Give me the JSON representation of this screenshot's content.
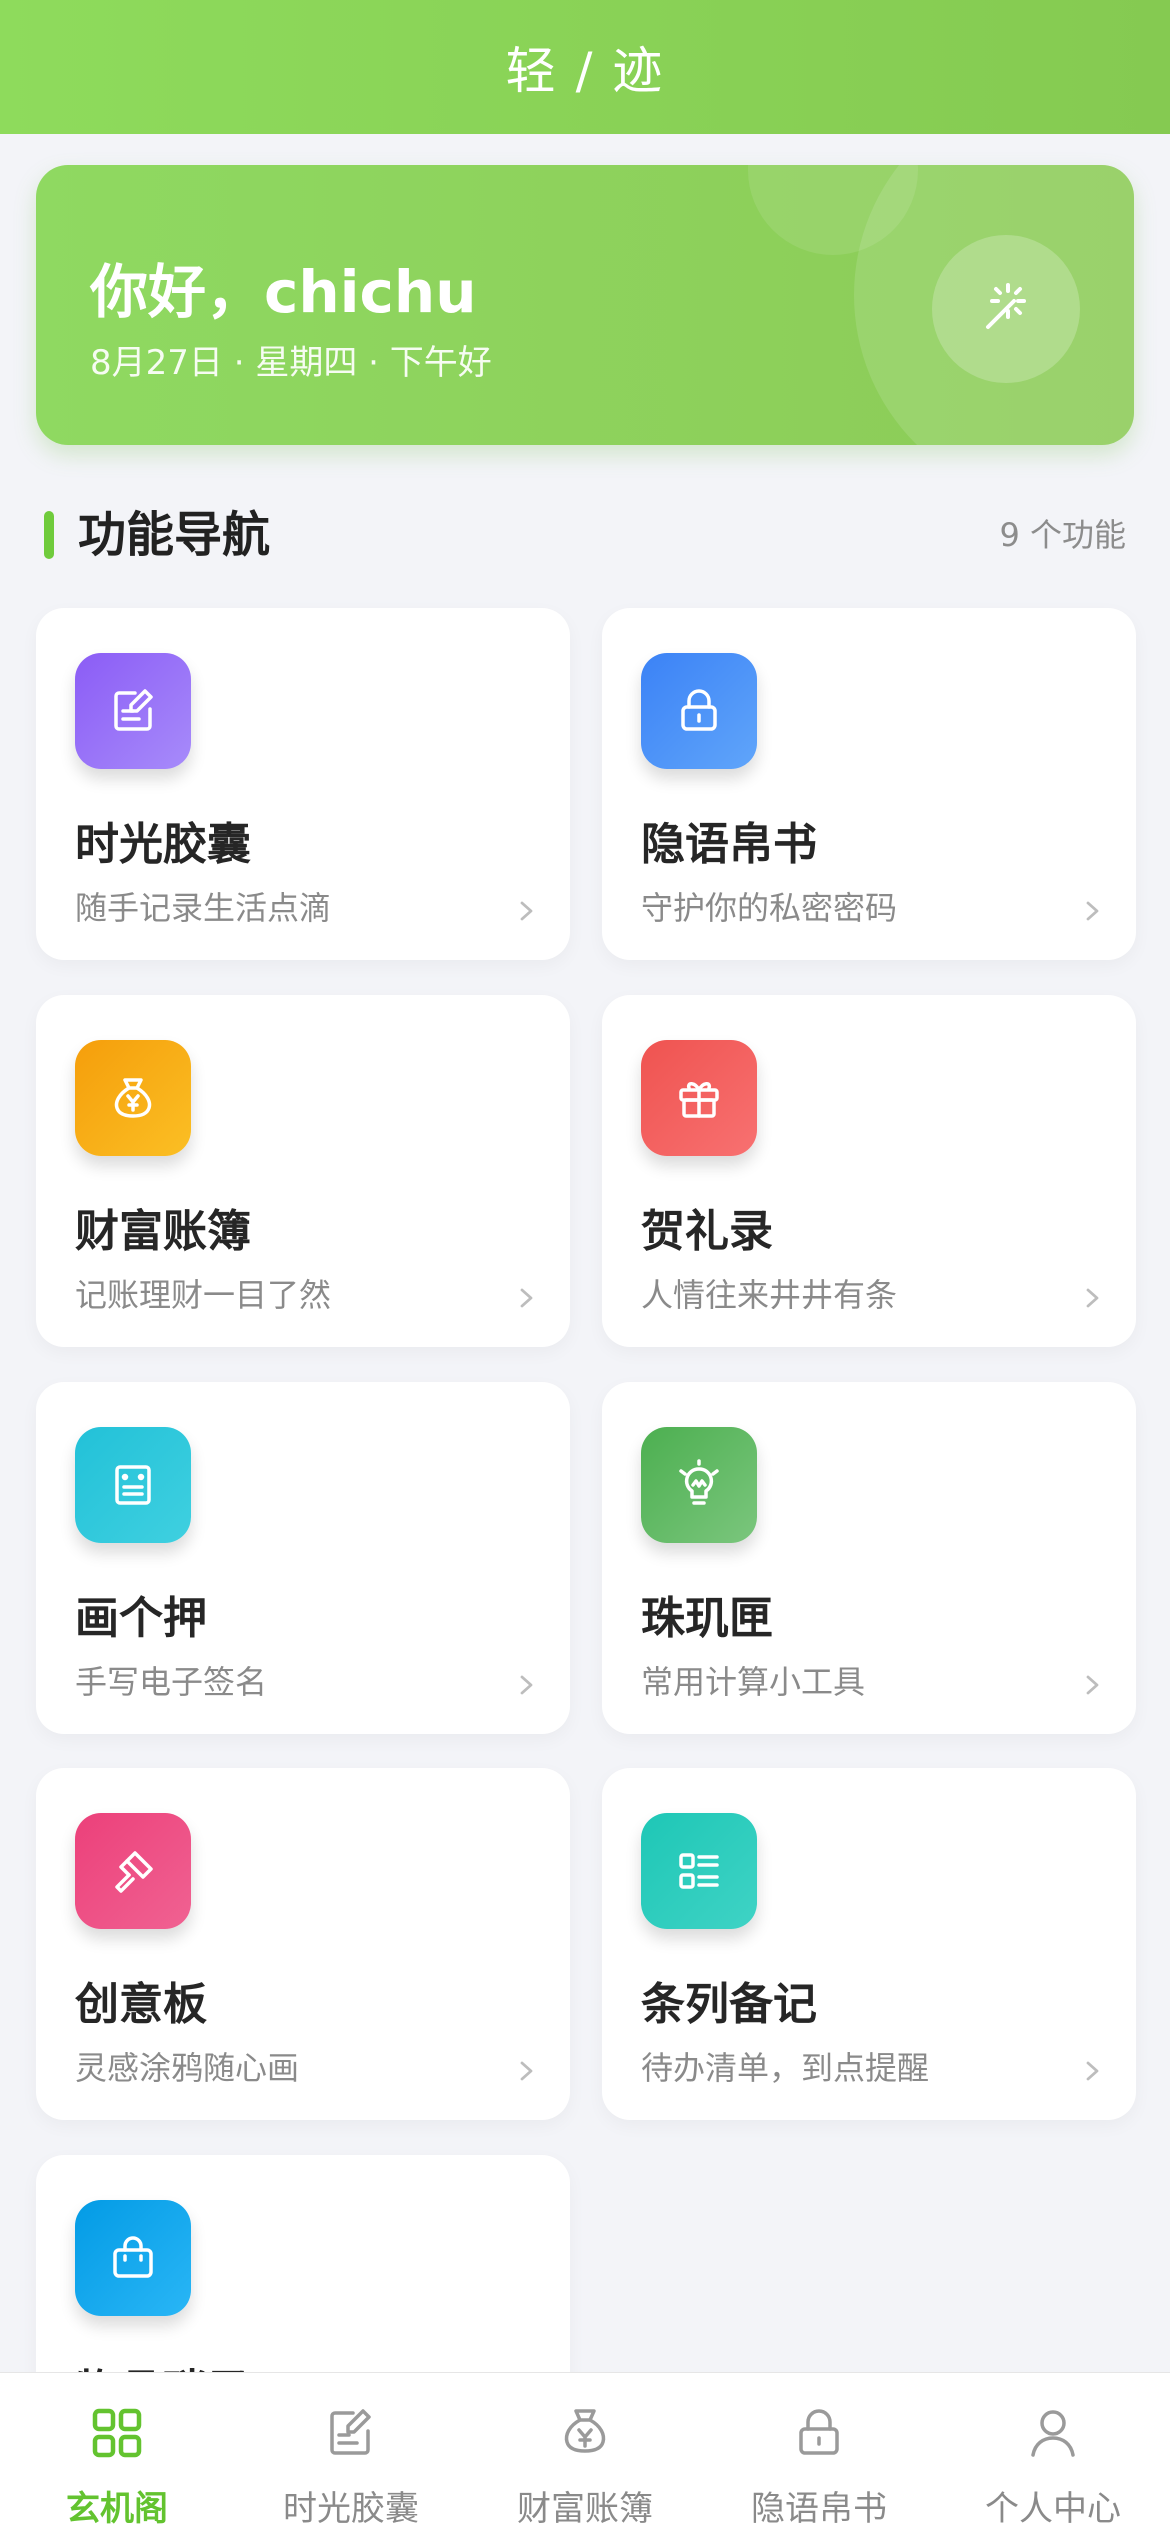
{
  "header": {
    "title": "轻 / 迹"
  },
  "hero": {
    "greeting": "你好，chichu",
    "date_line": "8月27日 · 星期四 · 下午好",
    "icon": "magic-wand-icon"
  },
  "section": {
    "title": "功能导航",
    "count": "9 个功能"
  },
  "features": [
    {
      "name": "时光胶囊",
      "desc": "随手记录生活点滴",
      "icon": "notes-icon",
      "color_from": "#8b5cf6",
      "color_to": "#a78bfa"
    },
    {
      "name": "隐语帛书",
      "desc": "守护你的私密密码",
      "icon": "lock-icon",
      "color_from": "#3b82f6",
      "color_to": "#60a5fa"
    },
    {
      "name": "财富账簿",
      "desc": "记账理财一目了然",
      "icon": "money-bag-icon",
      "color_from": "#f59e0b",
      "color_to": "#fbbf24"
    },
    {
      "name": "贺礼录",
      "desc": "人情往来井井有条",
      "icon": "gift-icon",
      "color_from": "#ef5350",
      "color_to": "#f87171"
    },
    {
      "name": "画个押",
      "desc": "手写电子签名",
      "icon": "signature-pad-icon",
      "color_from": "#22c1d8",
      "color_to": "#3fd0e0"
    },
    {
      "name": "珠玑匣",
      "desc": "常用计算小工具",
      "icon": "lightbulb-icon",
      "color_from": "#4caf50",
      "color_to": "#7bc67d"
    },
    {
      "name": "创意板",
      "desc": "灵感涂鸦随心画",
      "icon": "paint-roller-icon",
      "color_from": "#ec407a",
      "color_to": "#f06292"
    },
    {
      "name": "条列备记",
      "desc": "待办清单，到点提醒",
      "icon": "checklist-icon",
      "color_from": "#1ec7b6",
      "color_to": "#3fd3c5"
    },
    {
      "name": "物品琐录",
      "desc": "",
      "icon": "shopping-bag-icon",
      "color_from": "#039be5",
      "color_to": "#29b6f6"
    }
  ],
  "tabbar": {
    "items": [
      {
        "label": "玄机阁",
        "icon": "grid-icon",
        "active": true
      },
      {
        "label": "时光胶囊",
        "icon": "notes-icon",
        "active": false
      },
      {
        "label": "财富账簿",
        "icon": "money-bag-icon",
        "active": false
      },
      {
        "label": "隐语帛书",
        "icon": "lock-icon",
        "active": false
      },
      {
        "label": "个人中心",
        "icon": "user-icon",
        "active": false
      }
    ]
  },
  "colors": {
    "accent": "#63c32f",
    "header_from": "#8edb5c",
    "header_to": "#85ca51",
    "background": "#f3f4f8"
  }
}
